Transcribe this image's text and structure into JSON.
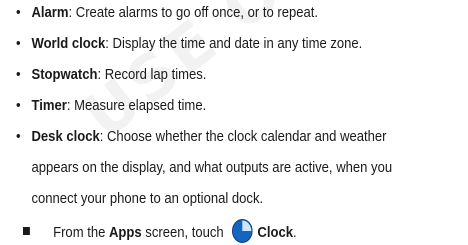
{
  "watermark": "USE ONLY",
  "items": [
    {
      "term": "Alarm",
      "desc": ": Create alarms to go off once, or to repeat."
    },
    {
      "term": "World clock",
      "desc": ": Display the time and date in any time zone."
    },
    {
      "term": "Stopwatch",
      "desc": ": Record lap times."
    },
    {
      "term": "Timer",
      "desc": ": Measure elapsed time."
    },
    {
      "term": "Desk clock",
      "desc": ": Choose whether the clock calendar and weather",
      "cont1": "appears on the display, and what outputs are active, when you",
      "cont2": "connect your phone to an optional dock."
    }
  ],
  "step": {
    "prefix": "From the ",
    "apps": "Apps",
    "middle": " screen, touch ",
    "clock": "Clock",
    "period": ".",
    "icon": "clock-icon"
  },
  "colors": {
    "text": "#1a1a1a",
    "icon_bg": "#1565c0"
  }
}
